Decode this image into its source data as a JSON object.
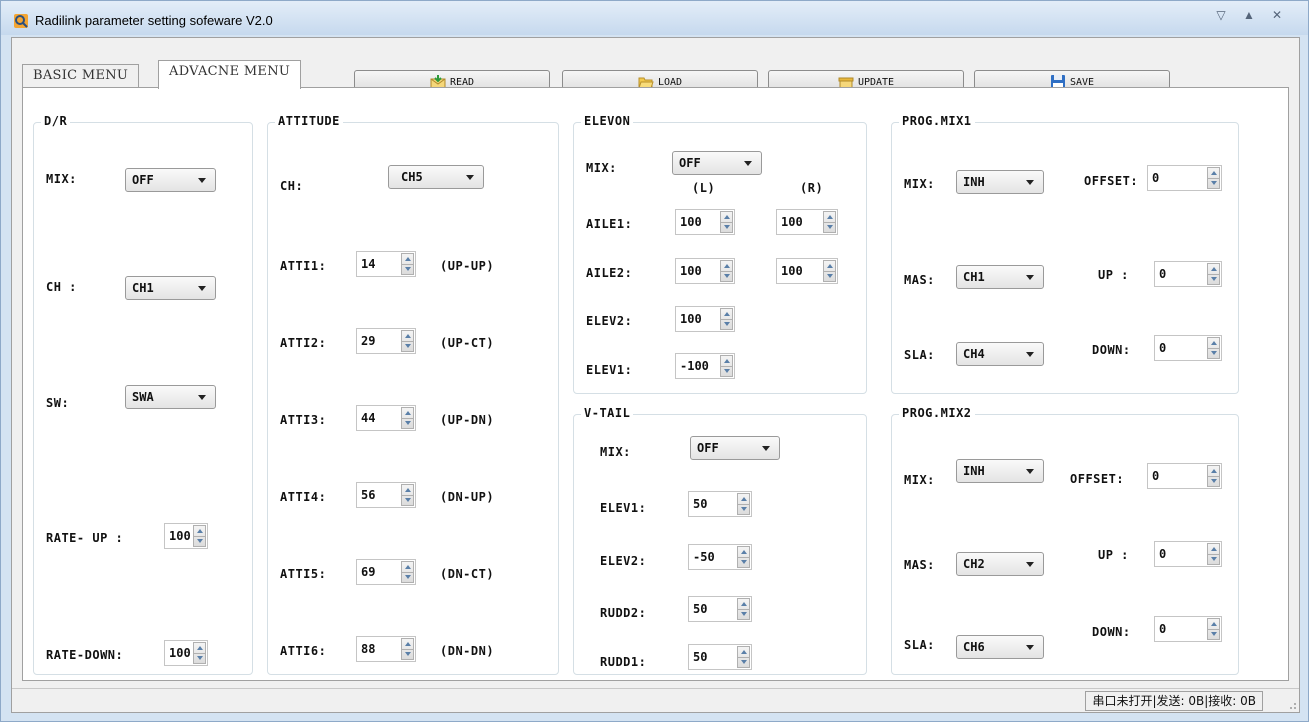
{
  "window": {
    "title": "Radilink parameter setting sofeware V2.0",
    "minimize": "▽",
    "restore": "▲",
    "close": "✕"
  },
  "tabs": [
    {
      "label": "BASIC MENU",
      "active": false
    },
    {
      "label": "ADVACNE MENU",
      "active": true
    }
  ],
  "toolbar": {
    "read": "READ",
    "load": "LOAD",
    "update": "UPDATE",
    "save": "SAVE"
  },
  "dr": {
    "title": "D/R",
    "mix_label": "MIX:",
    "mix_value": "OFF",
    "ch_label": "CH :",
    "ch_value": "CH1",
    "sw_label": "SW:",
    "sw_value": "SWA",
    "rate_up_label": "RATE- UP :",
    "rate_up_value": "100",
    "rate_down_label": "RATE-DOWN:",
    "rate_down_value": "100"
  },
  "attitude": {
    "title": "ATTITUDE",
    "ch_label": "CH:",
    "ch_value": "CH5",
    "rows": [
      {
        "label": "ATTI1:",
        "value": "14",
        "desc": "(UP-UP)"
      },
      {
        "label": "ATTI2:",
        "value": "29",
        "desc": "(UP-CT)"
      },
      {
        "label": "ATTI3:",
        "value": "44",
        "desc": "(UP-DN)"
      },
      {
        "label": "ATTI4:",
        "value": "56",
        "desc": "(DN-UP)"
      },
      {
        "label": "ATTI5:",
        "value": "69",
        "desc": "(DN-CT)"
      },
      {
        "label": "ATTI6:",
        "value": "88",
        "desc": "(DN-DN)"
      }
    ]
  },
  "elevon": {
    "title": "ELEVON",
    "mix_label": "MIX:",
    "mix_value": "OFF",
    "col_l": "(L)",
    "col_r": "(R)",
    "aile1_label": "AILE1:",
    "aile1_l": "100",
    "aile1_r": "100",
    "aile2_label": "AILE2:",
    "aile2_l": "100",
    "aile2_r": "100",
    "elev2_label": "ELEV2:",
    "elev2_value": "100",
    "elev1_label": "ELEV1:",
    "elev1_value": "-100"
  },
  "vtail": {
    "title": "V-TAIL",
    "mix_label": "MIX:",
    "mix_value": "OFF",
    "rows": [
      {
        "label": "ELEV1:",
        "value": "50"
      },
      {
        "label": "ELEV2:",
        "value": "-50"
      },
      {
        "label": "RUDD2:",
        "value": "50"
      },
      {
        "label": "RUDD1:",
        "value": "50"
      }
    ]
  },
  "prog1": {
    "title": "PROG.MIX1",
    "mix_label": "MIX:",
    "mix_value": "INH",
    "mas_label": "MAS:",
    "mas_value": "CH1",
    "sla_label": "SLA:",
    "sla_value": "CH4",
    "offset_label": "OFFSET:",
    "offset_value": "0",
    "up_label": "UP :",
    "up_value": "0",
    "down_label": "DOWN:",
    "down_value": "0"
  },
  "prog2": {
    "title": "PROG.MIX2",
    "mix_label": "MIX:",
    "mix_value": "INH",
    "mas_label": "MAS:",
    "mas_value": "CH2",
    "sla_label": "SLA:",
    "sla_value": "CH6",
    "offset_label": "OFFSET:",
    "offset_value": "0",
    "up_label": "UP :",
    "up_value": "0",
    "down_label": "DOWN:",
    "down_value": "0"
  },
  "status": {
    "text": "串口未打开|发送: 0B|接收: 0B"
  }
}
